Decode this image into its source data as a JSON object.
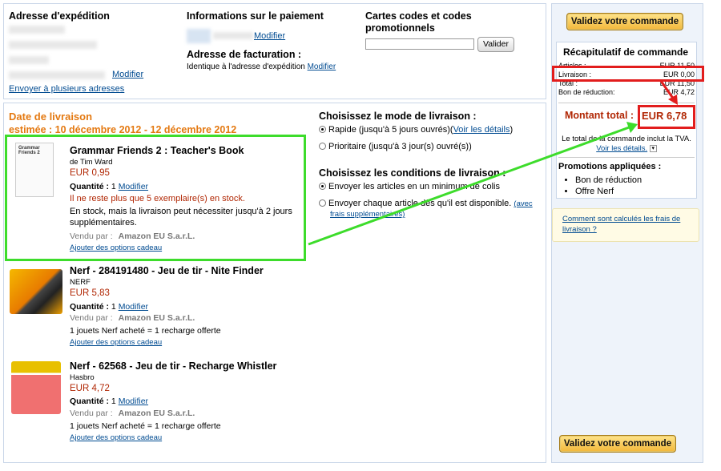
{
  "shipping": {
    "title": "Adresse d'expédition",
    "modify": "Modifier",
    "send_multiple": "Envoyer à plusieurs adresses"
  },
  "payment": {
    "title": "Informations sur le paiement",
    "modify": "Modifier",
    "billing_title": "Adresse de facturation :",
    "billing_value": "Identique à l'adresse d'expédition",
    "billing_modify": "Modifier"
  },
  "promo": {
    "title_line1": "Cartes codes et codes",
    "title_line2": "promotionnels",
    "input_value": "",
    "apply_button": "Valider"
  },
  "delivery": {
    "title": "Date de livraison",
    "estimate": "estimée : 10 décembre 2012 - 12 décembre 2012"
  },
  "items": [
    {
      "title": "Grammar Friends 2 : Teacher's Book",
      "by": "de Tim Ward",
      "price": "EUR 0,95",
      "qty_label": "Quantité :",
      "qty": "1",
      "qty_modify": "Modifier",
      "stock_warning": "Il ne reste plus que 5 exemplaire(s) en stock.",
      "stock_note": "En stock, mais la livraison peut nécessiter jusqu'à 2 jours supplémentaires.",
      "sold_by_label": "Vendu par :",
      "sold_by": "Amazon EU S.a.r.L.",
      "gift": "Ajouter des options cadeau",
      "thumb_text": "Grammar Friends 2"
    },
    {
      "title": "Nerf - 284191480 - Jeu de tir - Nite Finder",
      "by": "NERF",
      "price": "EUR 5,83",
      "qty_label": "Quantité :",
      "qty": "1",
      "qty_modify": "Modifier",
      "sold_by_label": "Vendu par :",
      "sold_by": "Amazon EU S.a.r.L.",
      "promo_note": "1 jouets Nerf acheté = 1 recharge offerte",
      "gift": "Ajouter des options cadeau"
    },
    {
      "title": "Nerf - 62568 - Jeu de tir - Recharge Whistler",
      "by": "Hasbro",
      "price": "EUR 4,72",
      "qty_label": "Quantité :",
      "qty": "1",
      "qty_modify": "Modifier",
      "sold_by_label": "Vendu par :",
      "sold_by": "Amazon EU S.a.r.L.",
      "promo_note": "1 jouets Nerf acheté = 1 recharge offerte",
      "gift": "Ajouter des options cadeau"
    }
  ],
  "shipping_mode": {
    "title": "Choisissez le mode de livraison :",
    "option1": "Rapide (jusqu'à 5 jours ouvrés)",
    "option1_link": "Voir les détails",
    "option1_tail": ")",
    "option1_open": "(",
    "option2": "Prioritaire (jusqu'à 3 jour(s) ouvré(s))"
  },
  "shipping_conditions": {
    "title": "Choisissez les conditions de livraison :",
    "option1": "Envoyer les articles en un minimum de colis",
    "option2": "Envoyer chaque article dès qu'il est disponible.",
    "option2_link_a": "(avec",
    "option2_link_b": "frais supplémentaires)"
  },
  "sidebar": {
    "validate_button": "Validez votre commande",
    "summary_title": "Récapitulatif de commande",
    "rows": [
      {
        "label": "Articles :",
        "value": "EUR 11,50"
      },
      {
        "label": "Livraison :",
        "value": "EUR 0,00"
      },
      {
        "label": "Total :",
        "value": "EUR 11,50"
      },
      {
        "label": "Bon de réduction:",
        "value": "EUR 4,72"
      }
    ],
    "total_label": "Montant total :",
    "total_value": "EUR 6,78",
    "vat_note": "Le total de la commande inclut la TVA.",
    "vat_link": "Voir les détails.",
    "promos_title": "Promotions appliquées :",
    "promos": [
      "Bon de réduction",
      "Offre Nerf"
    ],
    "shipping_calc_link": "Comment sont calculés les frais de livraison ?",
    "validate_button_bottom": "Validez votre commande"
  },
  "colors": {
    "orange_title": "#e47911",
    "price": "#b12704",
    "highlight_green": "#3ddc2b",
    "highlight_red": "#e21d1d"
  }
}
